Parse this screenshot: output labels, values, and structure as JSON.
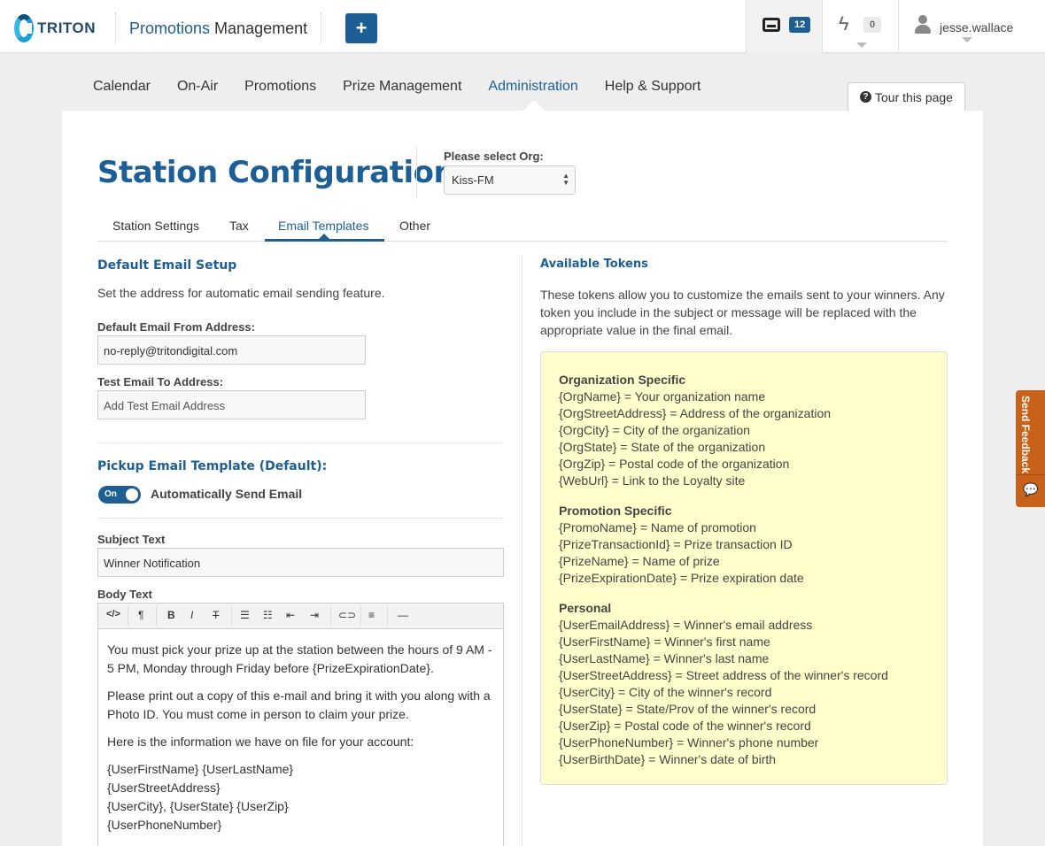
{
  "brand": {
    "logo_text": "TRITON",
    "app_title_accent": "Promotions",
    "app_title_rest": " Management",
    "add_label": "+"
  },
  "header": {
    "inbox_count": "12",
    "alerts_count": "0",
    "username": "jesse.wallace"
  },
  "nav": {
    "items": [
      "Calendar",
      "On-Air",
      "Promotions",
      "Prize Management",
      "Administration",
      "Help & Support"
    ],
    "active": "Administration",
    "tour_label": "Tour this page"
  },
  "page": {
    "title": "Station Configuration",
    "org_label": "Please select Org:",
    "org_value": "Kiss-FM",
    "tabs": [
      "Station Settings",
      "Tax",
      "Email Templates",
      "Other"
    ],
    "active_tab": "Email Templates"
  },
  "default_email": {
    "title": "Default Email Setup",
    "description": "Set the address for automatic email sending feature.",
    "from_label": "Default Email From Address:",
    "from_value": "no-reply@tritondigital.com",
    "test_label": "Test Email To Address:",
    "test_placeholder": "Add Test Email Address"
  },
  "pickup": {
    "title": "Pickup Email Template (Default):",
    "toggle_state": "On",
    "toggle_label": "Automatically Send Email",
    "subject_label": "Subject Text",
    "subject_value": "Winner Notification",
    "body_label": "Body Text",
    "toolbar": {
      "code": "</>",
      "para": "¶",
      "bold": "B",
      "italic": "I",
      "strike": "T",
      "ul": "☰",
      "ol": "☷",
      "outdent": "⇤",
      "indent": "⇥",
      "link": "⊂⊃",
      "align": "≡",
      "hr": "—"
    },
    "body": [
      "You must pick your prize up at the station between the hours of 9 AM - 5 PM, Monday through Friday before {PrizeExpirationDate}.",
      "Please print out a copy of this e-mail and bring it with you along with a Photo ID. You must come in person to claim your prize.",
      "Here is the information we have on file for your account:"
    ],
    "body_lines": [
      "{UserFirstName} {UserLastName}",
      "{UserStreetAddress}",
      "{UserCity}, {UserState} {UserZip}",
      "{UserPhoneNumber}"
    ]
  },
  "tokens": {
    "title": "Available Tokens",
    "description": "These tokens allow you to customize the emails sent to your winners. Any token you include in the subject or message will be replaced with the appropriate value in the final email.",
    "groups": [
      {
        "name": "Organization Specific",
        "items": [
          "{OrgName} = Your organization name",
          "{OrgStreetAddress} = Address of the organization",
          "{OrgCity} = City of the organization",
          "{OrgState} = State of the organization",
          "{OrgZip} = Postal code of the organization",
          "{WebUrl} = Link to the Loyalty site"
        ]
      },
      {
        "name": "Promotion Specific",
        "items": [
          "{PromoName} = Name of promotion",
          "{PrizeTransactionId} = Prize transaction ID",
          "{PrizeName} = Name of prize",
          "{PrizeExpirationDate} = Prize expiration date"
        ]
      },
      {
        "name": "Personal",
        "items": [
          "{UserEmailAddress} = Winner's email address",
          "{UserFirstName} = Winner's first name",
          "{UserLastName} = Winner's last name",
          "{UserStreetAddress} = Street address of the winner's record",
          "{UserCity} = City of the winner's record",
          "{UserState} = State/Prov of the winner's record",
          "{UserZip} = Postal code of the winner's record",
          "{UserPhoneNumber} = Winner's phone number",
          "{UserBirthDate} = Winner's date of birth"
        ]
      }
    ]
  },
  "feedback": {
    "label": "Send Feedback",
    "icon": "chat-icon"
  },
  "colors": {
    "brand_blue": "#1d5f95",
    "token_bg": "#ffffcc",
    "feedback_orange": "#c8621a"
  }
}
